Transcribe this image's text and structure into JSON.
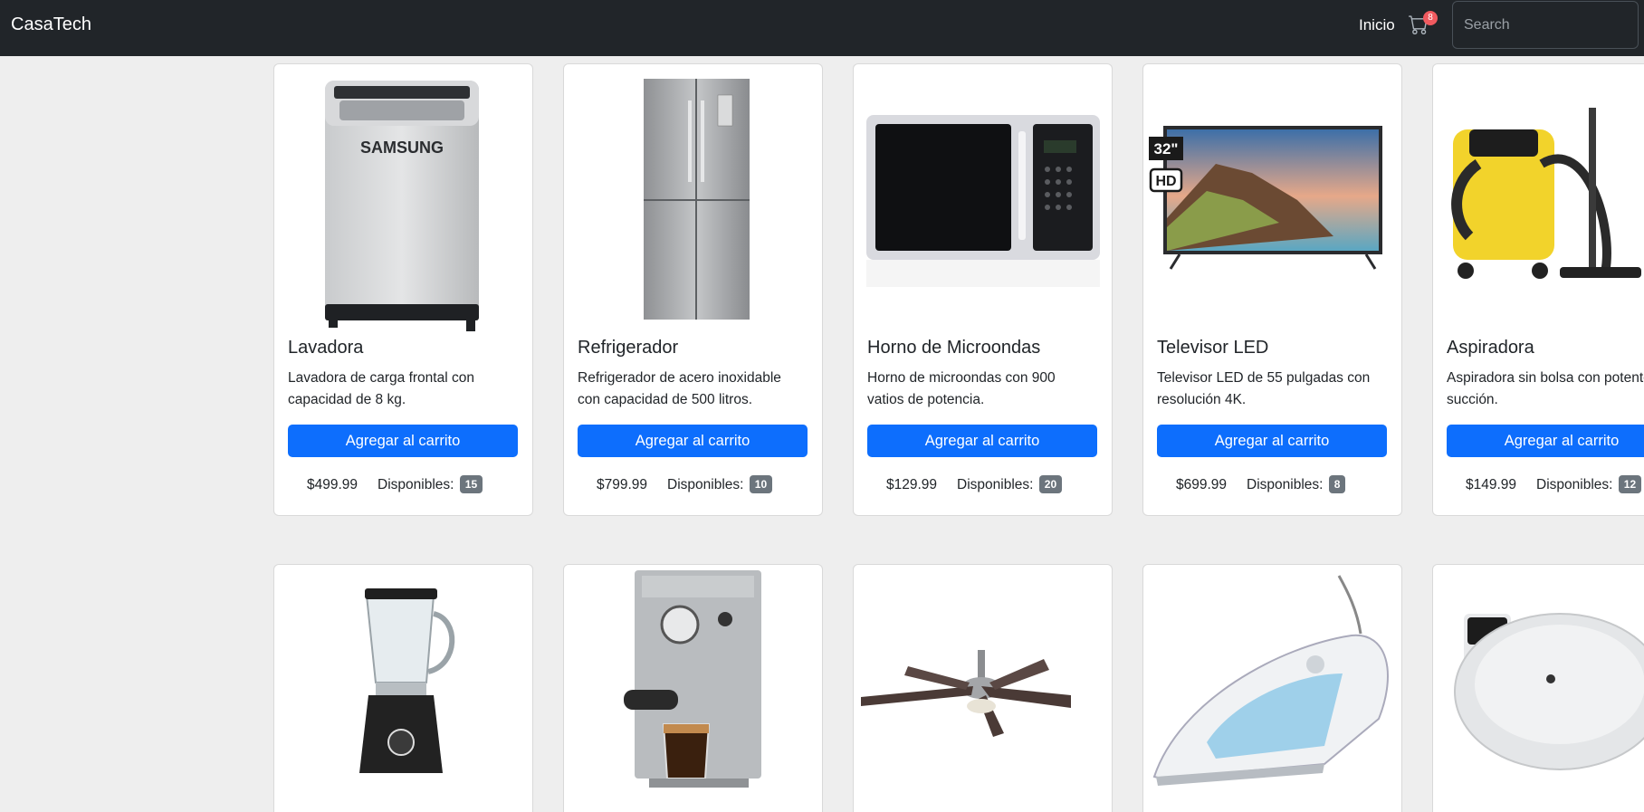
{
  "navbar": {
    "brand": "CasaTech",
    "links": [
      "Inicio"
    ],
    "cart_count": "8",
    "search_placeholder": "Search"
  },
  "products": [
    {
      "name": "Lavadora",
      "description": [
        "Lavadora de carga frontal con",
        "capacidad de 8 kg."
      ],
      "button": "Agregar al carrito",
      "price": "$499.99",
      "stock_label": "Disponibles:",
      "stock": "15",
      "image_text": "SAMSUNG"
    },
    {
      "name": "Refrigerador",
      "description": [
        "Refrigerador de acero inoxidable",
        "con capacidad de 500 litros."
      ],
      "button": "Agregar al carrito",
      "price": "$799.99",
      "stock_label": "Disponibles:",
      "stock": "10"
    },
    {
      "name": "Horno de Microondas",
      "description": [
        "Horno de microondas con 900",
        "vatios de potencia."
      ],
      "button": "Agregar al carrito",
      "price": "$129.99",
      "stock_label": "Disponibles:",
      "stock": "20"
    },
    {
      "name": "Televisor LED",
      "description": [
        "Televisor LED de 55 pulgadas con",
        "resolución 4K."
      ],
      "button": "Agregar al carrito",
      "price": "$699.99",
      "stock_label": "Disponibles:",
      "stock": "8",
      "image_tags": [
        "32\"",
        "HD"
      ]
    },
    {
      "name": "Aspiradora",
      "description": [
        "Aspiradora sin bolsa con potente",
        "succión."
      ],
      "button": "Agregar al carrito",
      "price": "$149.99",
      "stock_label": "Disponibles:",
      "stock": "12"
    }
  ],
  "products_row2": [
    {
      "image": "blender"
    },
    {
      "image": "espresso-machine"
    },
    {
      "image": "ceiling-fan"
    },
    {
      "image": "steam-iron"
    },
    {
      "image": "robot-vacuum"
    }
  ],
  "colors": {
    "navbar": "#212529",
    "primary": "#0d6efd",
    "badge": "#6c757d",
    "cart_badge": "#f05a5f",
    "background": "#eeeeee"
  }
}
